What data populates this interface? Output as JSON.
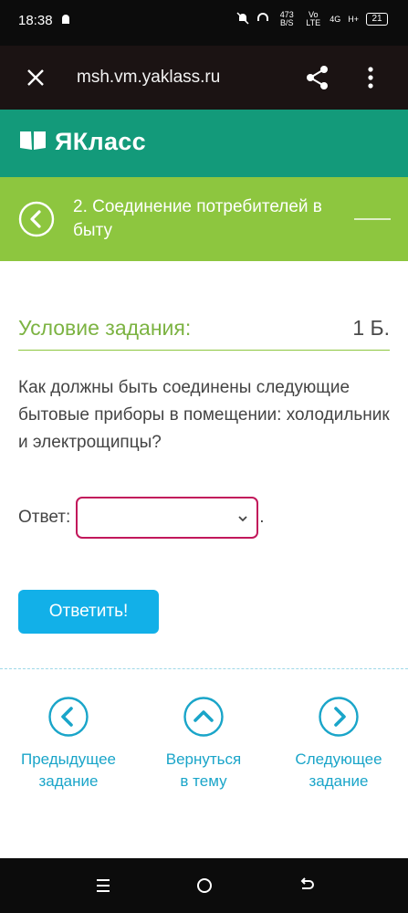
{
  "status": {
    "time": "18:38",
    "net_speed": "473 B/S",
    "carrier_a": "Vo LTE",
    "carrier_b": "4G",
    "carrier_c": "H+",
    "battery": "21"
  },
  "browser": {
    "url": "msh.vm.yaklass.ru"
  },
  "brand": {
    "name": "ЯКласс",
    "color": "#139a7a"
  },
  "topic": {
    "title": "2. Соединение потребителей в быту",
    "color": "#8dc63f"
  },
  "task": {
    "heading": "Условие задания:",
    "points": "1 Б.",
    "question": "Как должны быть соединены следующие бытовые приборы в помещении: холодильник и электрощипцы?",
    "answer_label": "Ответ:",
    "answer_value": "",
    "answer_suffix": ".",
    "submit_label": "Ответить!"
  },
  "navigation": {
    "prev_line1": "Предыдущее",
    "prev_line2": "задание",
    "up_line1": "Вернуться",
    "up_line2": "в тему",
    "next_line1": "Следующее",
    "next_line2": "задание",
    "accent": "#1aa5c9"
  },
  "icons": {
    "close": "close-icon",
    "share": "share-icon",
    "more": "more-vertical-icon",
    "book": "book-icon",
    "back": "chevron-left-icon",
    "chevron_down": "chevron-down-icon"
  }
}
